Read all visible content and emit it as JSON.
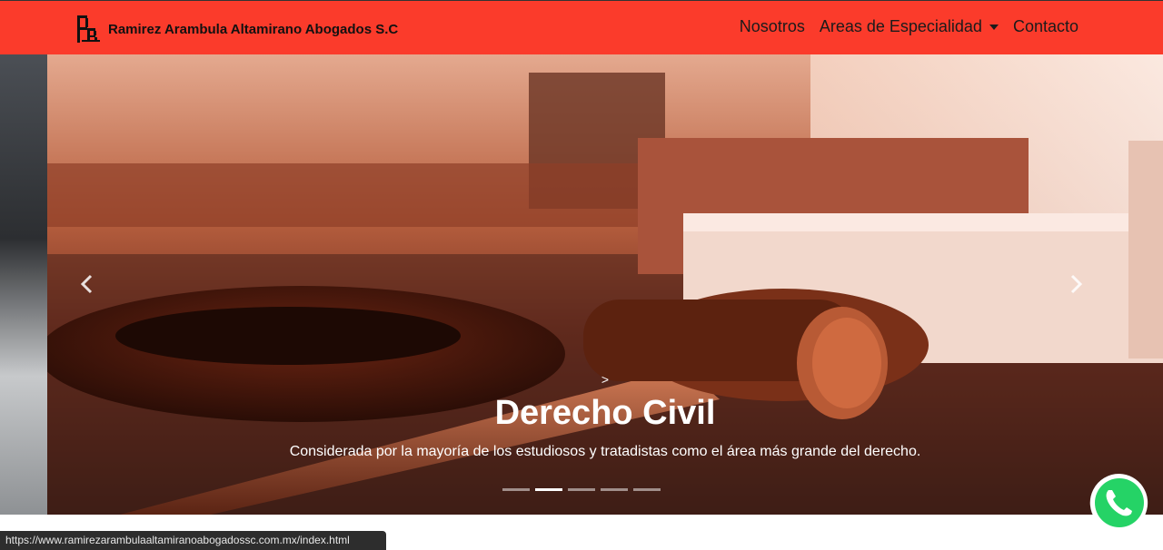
{
  "brand": {
    "name": "Ramirez Arambula Altamirano Abogados S.C"
  },
  "nav": {
    "items": [
      {
        "label": "Nosotros"
      },
      {
        "label": "Areas de Especialidad"
      },
      {
        "label": "Contacto"
      }
    ]
  },
  "carousel": {
    "caption_arrow": ">",
    "title": "Derecho Civil",
    "text": "Considerada por la mayoría de los estudiosos y tratadistas como el área más grande del derecho.",
    "indicator_count": 5,
    "active_index": 1
  },
  "status_bar": {
    "url": "https://www.ramirezarambulaaltamiranoabogadossc.com.mx/index.html"
  },
  "colors": {
    "navbar": "#fb3b2b",
    "whatsapp": "#25d366"
  },
  "icons": [
    "logo-icon",
    "prev-arrow-icon",
    "next-arrow-icon",
    "whatsapp-icon"
  ]
}
